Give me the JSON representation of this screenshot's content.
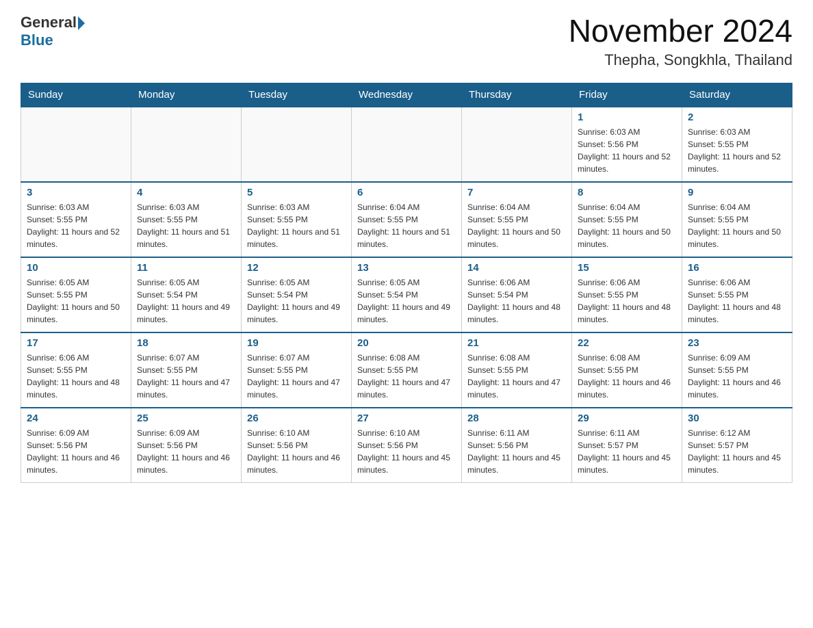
{
  "header": {
    "logo_general": "General",
    "logo_blue": "Blue",
    "month_year": "November 2024",
    "location": "Thepha, Songkhla, Thailand"
  },
  "days_of_week": [
    "Sunday",
    "Monday",
    "Tuesday",
    "Wednesday",
    "Thursday",
    "Friday",
    "Saturday"
  ],
  "weeks": [
    [
      {
        "day": "",
        "sunrise": "",
        "sunset": "",
        "daylight": "",
        "empty": true
      },
      {
        "day": "",
        "sunrise": "",
        "sunset": "",
        "daylight": "",
        "empty": true
      },
      {
        "day": "",
        "sunrise": "",
        "sunset": "",
        "daylight": "",
        "empty": true
      },
      {
        "day": "",
        "sunrise": "",
        "sunset": "",
        "daylight": "",
        "empty": true
      },
      {
        "day": "",
        "sunrise": "",
        "sunset": "",
        "daylight": "",
        "empty": true
      },
      {
        "day": "1",
        "sunrise": "Sunrise: 6:03 AM",
        "sunset": "Sunset: 5:56 PM",
        "daylight": "Daylight: 11 hours and 52 minutes.",
        "empty": false
      },
      {
        "day": "2",
        "sunrise": "Sunrise: 6:03 AM",
        "sunset": "Sunset: 5:55 PM",
        "daylight": "Daylight: 11 hours and 52 minutes.",
        "empty": false
      }
    ],
    [
      {
        "day": "3",
        "sunrise": "Sunrise: 6:03 AM",
        "sunset": "Sunset: 5:55 PM",
        "daylight": "Daylight: 11 hours and 52 minutes.",
        "empty": false
      },
      {
        "day": "4",
        "sunrise": "Sunrise: 6:03 AM",
        "sunset": "Sunset: 5:55 PM",
        "daylight": "Daylight: 11 hours and 51 minutes.",
        "empty": false
      },
      {
        "day": "5",
        "sunrise": "Sunrise: 6:03 AM",
        "sunset": "Sunset: 5:55 PM",
        "daylight": "Daylight: 11 hours and 51 minutes.",
        "empty": false
      },
      {
        "day": "6",
        "sunrise": "Sunrise: 6:04 AM",
        "sunset": "Sunset: 5:55 PM",
        "daylight": "Daylight: 11 hours and 51 minutes.",
        "empty": false
      },
      {
        "day": "7",
        "sunrise": "Sunrise: 6:04 AM",
        "sunset": "Sunset: 5:55 PM",
        "daylight": "Daylight: 11 hours and 50 minutes.",
        "empty": false
      },
      {
        "day": "8",
        "sunrise": "Sunrise: 6:04 AM",
        "sunset": "Sunset: 5:55 PM",
        "daylight": "Daylight: 11 hours and 50 minutes.",
        "empty": false
      },
      {
        "day": "9",
        "sunrise": "Sunrise: 6:04 AM",
        "sunset": "Sunset: 5:55 PM",
        "daylight": "Daylight: 11 hours and 50 minutes.",
        "empty": false
      }
    ],
    [
      {
        "day": "10",
        "sunrise": "Sunrise: 6:05 AM",
        "sunset": "Sunset: 5:55 PM",
        "daylight": "Daylight: 11 hours and 50 minutes.",
        "empty": false
      },
      {
        "day": "11",
        "sunrise": "Sunrise: 6:05 AM",
        "sunset": "Sunset: 5:54 PM",
        "daylight": "Daylight: 11 hours and 49 minutes.",
        "empty": false
      },
      {
        "day": "12",
        "sunrise": "Sunrise: 6:05 AM",
        "sunset": "Sunset: 5:54 PM",
        "daylight": "Daylight: 11 hours and 49 minutes.",
        "empty": false
      },
      {
        "day": "13",
        "sunrise": "Sunrise: 6:05 AM",
        "sunset": "Sunset: 5:54 PM",
        "daylight": "Daylight: 11 hours and 49 minutes.",
        "empty": false
      },
      {
        "day": "14",
        "sunrise": "Sunrise: 6:06 AM",
        "sunset": "Sunset: 5:54 PM",
        "daylight": "Daylight: 11 hours and 48 minutes.",
        "empty": false
      },
      {
        "day": "15",
        "sunrise": "Sunrise: 6:06 AM",
        "sunset": "Sunset: 5:55 PM",
        "daylight": "Daylight: 11 hours and 48 minutes.",
        "empty": false
      },
      {
        "day": "16",
        "sunrise": "Sunrise: 6:06 AM",
        "sunset": "Sunset: 5:55 PM",
        "daylight": "Daylight: 11 hours and 48 minutes.",
        "empty": false
      }
    ],
    [
      {
        "day": "17",
        "sunrise": "Sunrise: 6:06 AM",
        "sunset": "Sunset: 5:55 PM",
        "daylight": "Daylight: 11 hours and 48 minutes.",
        "empty": false
      },
      {
        "day": "18",
        "sunrise": "Sunrise: 6:07 AM",
        "sunset": "Sunset: 5:55 PM",
        "daylight": "Daylight: 11 hours and 47 minutes.",
        "empty": false
      },
      {
        "day": "19",
        "sunrise": "Sunrise: 6:07 AM",
        "sunset": "Sunset: 5:55 PM",
        "daylight": "Daylight: 11 hours and 47 minutes.",
        "empty": false
      },
      {
        "day": "20",
        "sunrise": "Sunrise: 6:08 AM",
        "sunset": "Sunset: 5:55 PM",
        "daylight": "Daylight: 11 hours and 47 minutes.",
        "empty": false
      },
      {
        "day": "21",
        "sunrise": "Sunrise: 6:08 AM",
        "sunset": "Sunset: 5:55 PM",
        "daylight": "Daylight: 11 hours and 47 minutes.",
        "empty": false
      },
      {
        "day": "22",
        "sunrise": "Sunrise: 6:08 AM",
        "sunset": "Sunset: 5:55 PM",
        "daylight": "Daylight: 11 hours and 46 minutes.",
        "empty": false
      },
      {
        "day": "23",
        "sunrise": "Sunrise: 6:09 AM",
        "sunset": "Sunset: 5:55 PM",
        "daylight": "Daylight: 11 hours and 46 minutes.",
        "empty": false
      }
    ],
    [
      {
        "day": "24",
        "sunrise": "Sunrise: 6:09 AM",
        "sunset": "Sunset: 5:56 PM",
        "daylight": "Daylight: 11 hours and 46 minutes.",
        "empty": false
      },
      {
        "day": "25",
        "sunrise": "Sunrise: 6:09 AM",
        "sunset": "Sunset: 5:56 PM",
        "daylight": "Daylight: 11 hours and 46 minutes.",
        "empty": false
      },
      {
        "day": "26",
        "sunrise": "Sunrise: 6:10 AM",
        "sunset": "Sunset: 5:56 PM",
        "daylight": "Daylight: 11 hours and 46 minutes.",
        "empty": false
      },
      {
        "day": "27",
        "sunrise": "Sunrise: 6:10 AM",
        "sunset": "Sunset: 5:56 PM",
        "daylight": "Daylight: 11 hours and 45 minutes.",
        "empty": false
      },
      {
        "day": "28",
        "sunrise": "Sunrise: 6:11 AM",
        "sunset": "Sunset: 5:56 PM",
        "daylight": "Daylight: 11 hours and 45 minutes.",
        "empty": false
      },
      {
        "day": "29",
        "sunrise": "Sunrise: 6:11 AM",
        "sunset": "Sunset: 5:57 PM",
        "daylight": "Daylight: 11 hours and 45 minutes.",
        "empty": false
      },
      {
        "day": "30",
        "sunrise": "Sunrise: 6:12 AM",
        "sunset": "Sunset: 5:57 PM",
        "daylight": "Daylight: 11 hours and 45 minutes.",
        "empty": false
      }
    ]
  ]
}
